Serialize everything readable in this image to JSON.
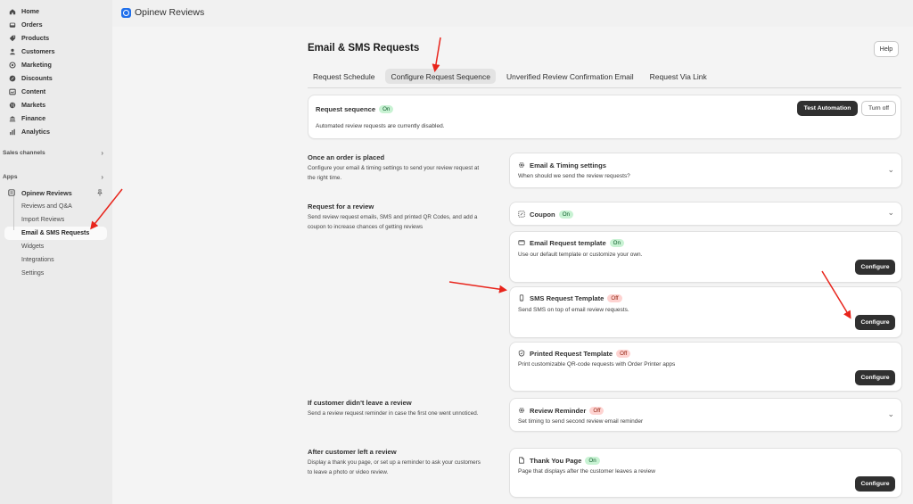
{
  "sidebar": {
    "nav": [
      {
        "label": "Home",
        "icon": "home-icon"
      },
      {
        "label": "Orders",
        "icon": "inbox-icon"
      },
      {
        "label": "Products",
        "icon": "tag-icon"
      },
      {
        "label": "Customers",
        "icon": "person-icon"
      },
      {
        "label": "Marketing",
        "icon": "target-icon"
      },
      {
        "label": "Discounts",
        "icon": "discount-icon"
      },
      {
        "label": "Content",
        "icon": "content-icon"
      },
      {
        "label": "Markets",
        "icon": "globe-icon"
      },
      {
        "label": "Finance",
        "icon": "bank-icon"
      },
      {
        "label": "Analytics",
        "icon": "chart-icon"
      }
    ],
    "sales_channels_label": "Sales channels",
    "apps_label": "Apps",
    "app_name": "Opinew Reviews",
    "app_subitems": [
      "Reviews and Q&A",
      "Import Reviews",
      "Email & SMS Requests",
      "Widgets",
      "Integrations",
      "Settings"
    ],
    "active_subitem": "Email & SMS Requests"
  },
  "topbar": {
    "app_title": "Opinew Reviews"
  },
  "page": {
    "title": "Email & SMS Requests",
    "help_label": "Help",
    "tabs": [
      "Request Schedule",
      "Configure Request Sequence",
      "Unverified Review Confirmation Email",
      "Request Via Link"
    ],
    "active_tab": "Configure Request Sequence"
  },
  "request_sequence": {
    "title": "Request sequence",
    "status": "On",
    "desc": "Automated review requests are currently disabled.",
    "test_label": "Test Automation",
    "turnoff_label": "Turn off"
  },
  "sections": {
    "order_placed": {
      "title": "Once an order is placed",
      "desc1": "Configure your email & timing settings to send your review request at",
      "desc2": "the right time."
    },
    "request_review": {
      "title": "Request for a review",
      "desc1": "Send review request emails, SMS and printed QR Codes, and add a",
      "desc2": "coupon to increase chances of getting reviews"
    },
    "no_review": {
      "title": "If customer didn't leave a review",
      "desc1": "Send a review request reminder in case the first one went unnoticed."
    },
    "left_review": {
      "title": "After customer left a review",
      "desc1": "Display a thank you page, or set up a reminder to ask your customers",
      "desc2": "to leave a photo or video review."
    }
  },
  "cards": {
    "email_timing": {
      "title": "Email & Timing settings",
      "desc": "When should we send the review requests?"
    },
    "coupon": {
      "title": "Coupon",
      "status": "On"
    },
    "email_template": {
      "title": "Email Request template",
      "status": "On",
      "desc": "Use our default template or customize your own.",
      "button": "Configure"
    },
    "sms_template": {
      "title": "SMS Request Template",
      "status": "Off",
      "desc": "Send SMS on top of email review requests.",
      "button": "Configure"
    },
    "printed_template": {
      "title": "Printed Request Template",
      "status": "Off",
      "desc": "Print customizable QR-code requests with Order Printer apps",
      "button": "Configure"
    },
    "review_reminder": {
      "title": "Review Reminder",
      "status": "Off",
      "desc": "Set timing to send second review email reminder"
    },
    "thank_you": {
      "title": "Thank You Page",
      "status": "On",
      "desc": "Page that displays after the customer leaves a review",
      "button": "Configure"
    }
  },
  "colors": {
    "arrow": "#e8241b",
    "on_badge": "#c8f2d3",
    "off_badge": "#fed3d1",
    "dark_button": "#303030",
    "brand_logo": "#1f6feb"
  }
}
